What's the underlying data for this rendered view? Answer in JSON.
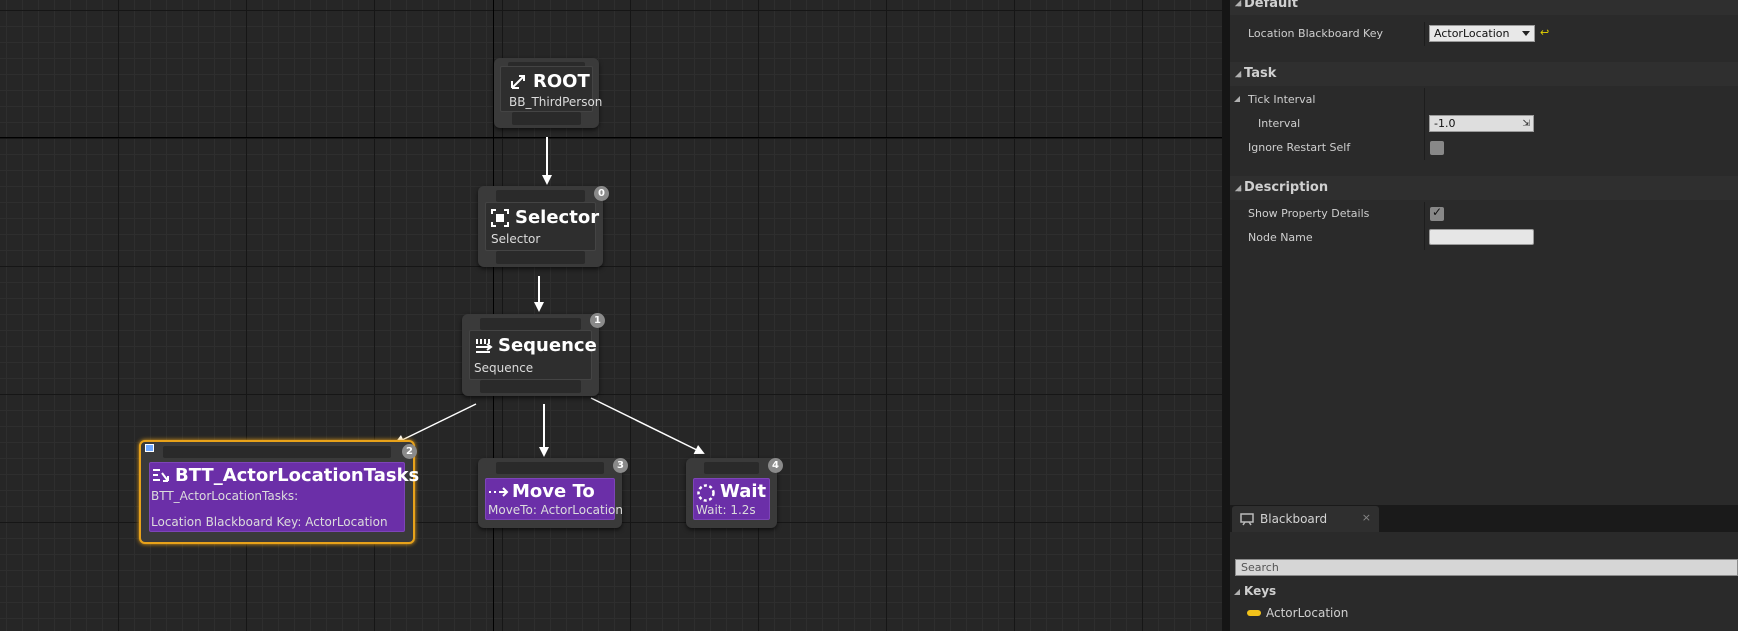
{
  "graph": {
    "nodes": {
      "root": {
        "title": "ROOT",
        "subtitle": "BB_ThirdPerson"
      },
      "selector": {
        "title": "Selector",
        "subtitle": "Selector",
        "index": "0"
      },
      "sequence": {
        "title": "Sequence",
        "subtitle": "Sequence",
        "index": "1"
      },
      "actor_task": {
        "title": "BTT_ActorLocationTasks",
        "subtitle": "BTT_ActorLocationTasks:",
        "detail": "Location Blackboard Key: ActorLocation",
        "index": "2"
      },
      "move_to": {
        "title": "Move To",
        "subtitle": "MoveTo: ActorLocation",
        "index": "3"
      },
      "wait": {
        "title": "Wait",
        "subtitle": "Wait: 1.2s",
        "index": "4"
      }
    },
    "colors": {
      "selected_outline": "#e8a21a",
      "task_purple": "#6b2fa8"
    }
  },
  "details": {
    "default": {
      "header": "Default",
      "location_key_label": "Location Blackboard Key",
      "location_key_value": "ActorLocation"
    },
    "task": {
      "header": "Task",
      "tick_interval_label": "Tick Interval",
      "interval_label": "Interval",
      "interval_value": "-1.0",
      "ignore_restart_label": "Ignore Restart Self",
      "ignore_restart_checked": false
    },
    "description": {
      "header": "Description",
      "show_details_label": "Show Property Details",
      "show_details_checked": true,
      "node_name_label": "Node Name",
      "node_name_value": ""
    }
  },
  "blackboard": {
    "tab_label": "Blackboard",
    "search_placeholder": "Search",
    "keys_header": "Keys",
    "keys": [
      "ActorLocation"
    ],
    "key_color": "#f2c21a"
  }
}
